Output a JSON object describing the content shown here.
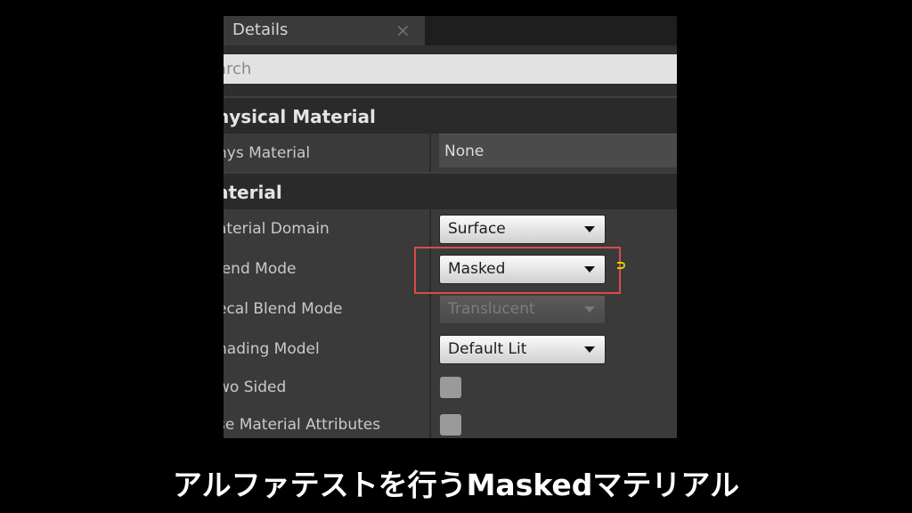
{
  "panel": {
    "tab_title": "Details",
    "tab_close": "×",
    "search_placeholder": "arch"
  },
  "sections": {
    "physical_material": {
      "title": "hysical Material",
      "rows": [
        {
          "label": "hys Material",
          "value": "None"
        }
      ]
    },
    "material": {
      "title": "aterial",
      "rows": [
        {
          "label": "aterial Domain",
          "value": "Surface"
        },
        {
          "label": "lend Mode",
          "value": "Masked"
        },
        {
          "label": "ecal Blend Mode",
          "value": "Translucent"
        },
        {
          "label": "hading Model",
          "value": "Default Lit"
        },
        {
          "label": "wo Sided",
          "checked": false
        },
        {
          "label": "se Material Attributes",
          "checked": false
        }
      ]
    }
  },
  "highlight_color": "#d94b4b",
  "caption": "アルファテストを行うMaskedマテリアル"
}
